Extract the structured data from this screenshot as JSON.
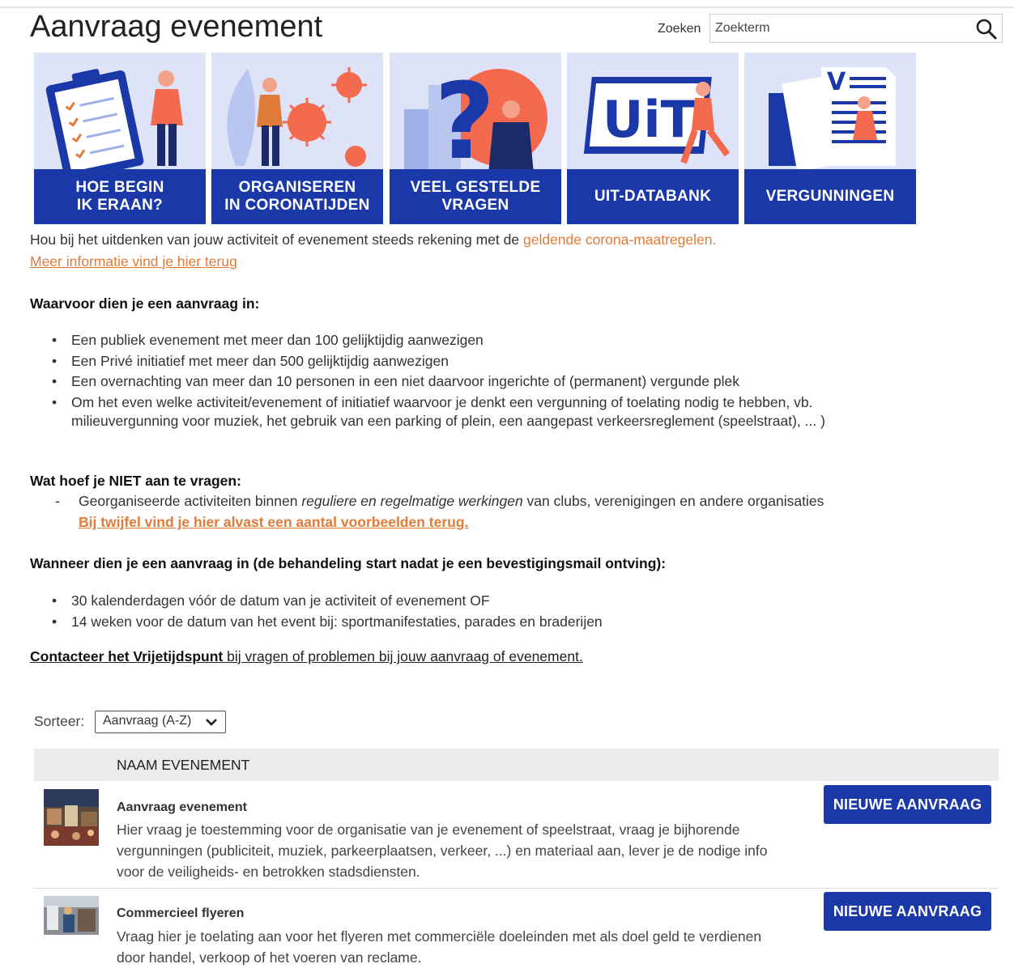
{
  "page": {
    "title": "Aanvraag evenement"
  },
  "search": {
    "label": "Zoeken",
    "placeholder": "Zoekterm"
  },
  "tiles": [
    {
      "label": "HOE BEGIN\nIK ERAAN?"
    },
    {
      "label": "ORGANISEREN\nIN CORONATIJDEN"
    },
    {
      "label": "VEEL GESTELDE\nVRAGEN"
    },
    {
      "label": "UIT-DATABANK"
    },
    {
      "label": "VERGUNNINGEN"
    }
  ],
  "uit_logo_text": "UiT",
  "intro": {
    "text": "Hou bij het uitdenken van jouw activiteit of evenement steeds rekening met de ",
    "link": "geldende corona-maatregelen",
    "end": ".",
    "more_link": "Meer informatie vind je hier terug"
  },
  "section_when_apply": {
    "heading": "Waarvoor dien je een aanvraag in:",
    "items": [
      "Een publiek evenement met meer dan 100 gelijktijdig aanwezigen",
      "Een Privé initiatief met meer dan 500 gelijktijdig aanwezigen",
      "Een overnachting van meer dan 10 personen in een niet daarvoor ingerichte of (permanent) vergunde plek",
      "Om het even welke activiteit/evenement of initiatief waarvoor je denkt een vergunning of toelating nodig te hebben, vb.",
      "milieuvergunning voor muziek, het gebruik van een parking of plein, een aangepast verkeersreglement (speelstraat), ... )"
    ]
  },
  "section_not": {
    "heading": "Wat hoef je NIET aan te vragen:",
    "dash": "-",
    "text_pre": "Georganiseerde activiteiten binnen ",
    "text_italic": "reguliere en regelmatige werkingen",
    "text_post": " van clubs, verenigingen en andere organisaties",
    "link": "Bij twijfel vind je hier alvast een aantal voorbeelden terug."
  },
  "section_timing": {
    "heading": "Wanneer dien je een aanvraag in (de behandeling start nadat je een bevestigingsmail ontving):",
    "items": [
      "30 kalenderdagen vóór de datum van je activiteit of evenement OF",
      "14 weken voor de datum van het event bij: sportmanifestaties, parades en braderijen"
    ]
  },
  "contact": {
    "bold": "Contacteer het Vrijetijdspunt",
    "rest": " bij vragen of problemen bij jouw aanvraag of evenement."
  },
  "sort": {
    "label": "Sorteer:",
    "value": "Aanvraag (A-Z)"
  },
  "table": {
    "header": "NAAM EVENEMENT",
    "rows": [
      {
        "title": "Aanvraag evenement",
        "desc1": "Hier vraag je toestemming voor de organisatie van je evenement of speelstraat, vraag je bijhorende",
        "desc2": "vergunningen (publiciteit, muziek, parkeerplaatsen, verkeer, ...) en materiaal aan, lever je de nodige info",
        "desc3": "voor de veiligheids- en betrokken stadsdiensten.",
        "button": "NIEUWE AANVRAAG"
      },
      {
        "title": "Commercieel flyeren",
        "desc1": "Vraag hier je toelating aan voor het flyeren met commerciële doeleinden met als doel geld te verdienen",
        "desc2": "door handel, verkoop of het voeren van reclame.",
        "button": "NIEUWE AANVRAAG"
      }
    ]
  },
  "colors": {
    "brand_blue": "#1b38a8",
    "accent_orange": "#e07b39",
    "tile_bg": "#dfe3f8"
  }
}
